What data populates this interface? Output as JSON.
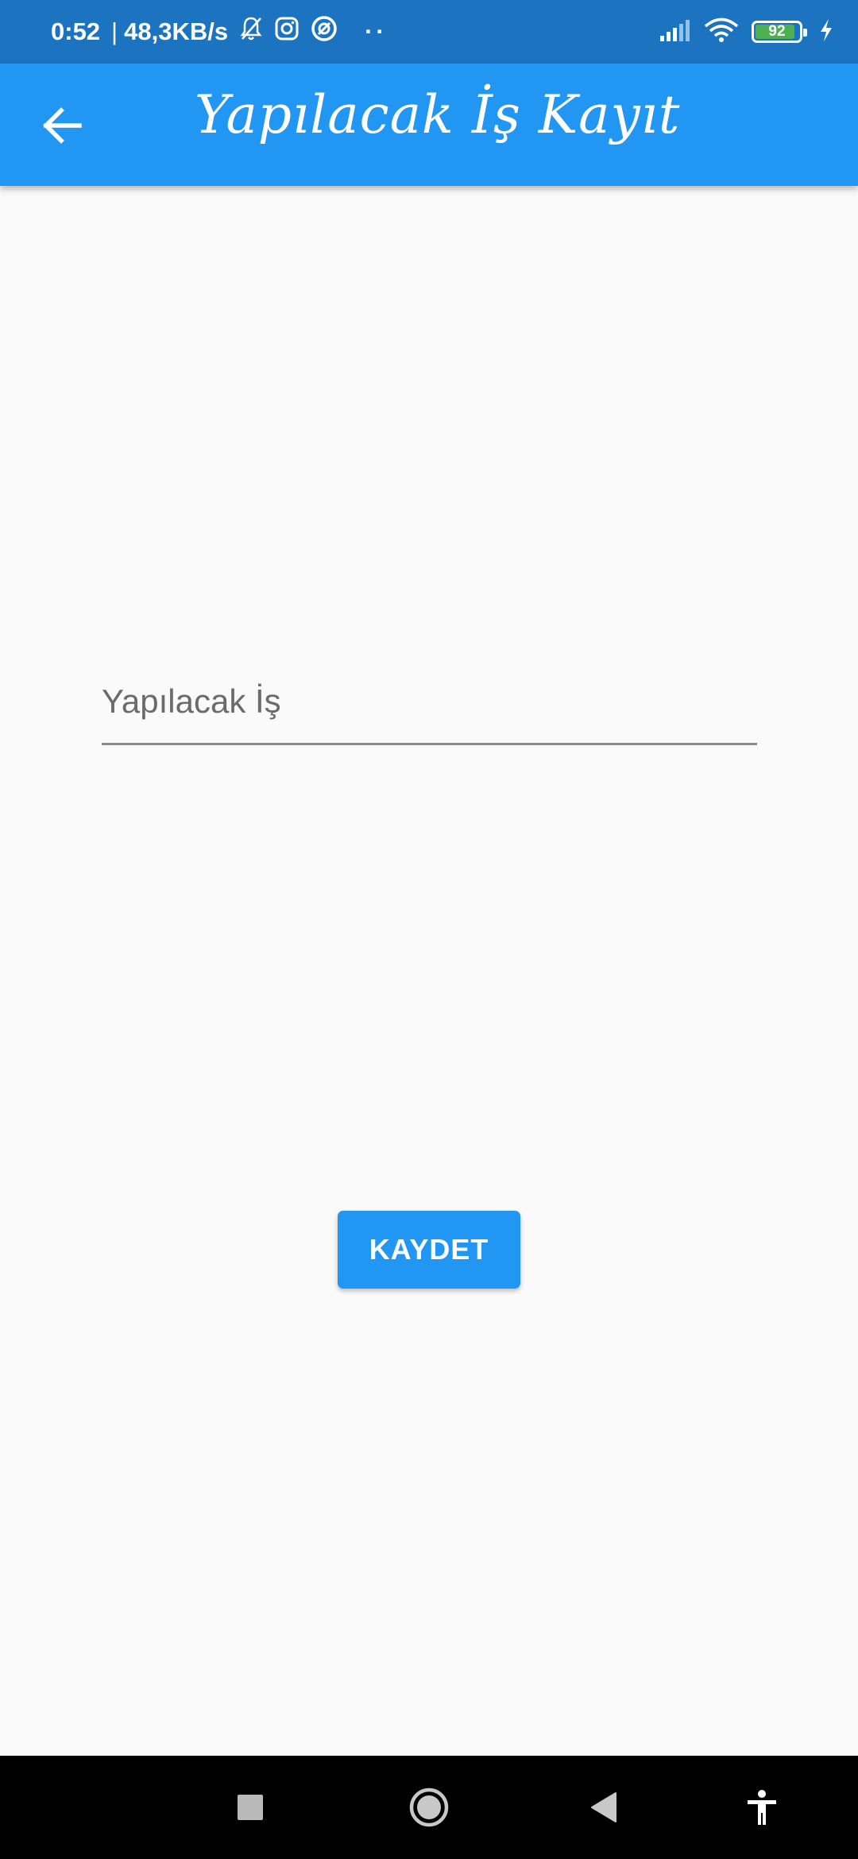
{
  "status_bar": {
    "time": "0:52",
    "separator": "|",
    "network_speed": "48,3KB/s",
    "more_indicator": "··",
    "battery_level": "92",
    "battery_fraction": 0.92,
    "icons": [
      "bell-muted-icon",
      "instagram-icon",
      "vpn-icon",
      "signal-icon",
      "wifi-icon",
      "battery-icon",
      "charging-icon"
    ],
    "battery_color": "#4caf50"
  },
  "app_bar": {
    "title": "Yapılacak İş Kayıt",
    "back_icon": "arrow-back-icon",
    "color": "#2196f3"
  },
  "form": {
    "task_placeholder": "Yapılacak İş",
    "task_value": "",
    "save_label": "KAYDET"
  },
  "nav_bar": {
    "buttons": [
      "recent-apps-icon",
      "home-icon",
      "back-icon",
      "accessibility-icon"
    ]
  }
}
